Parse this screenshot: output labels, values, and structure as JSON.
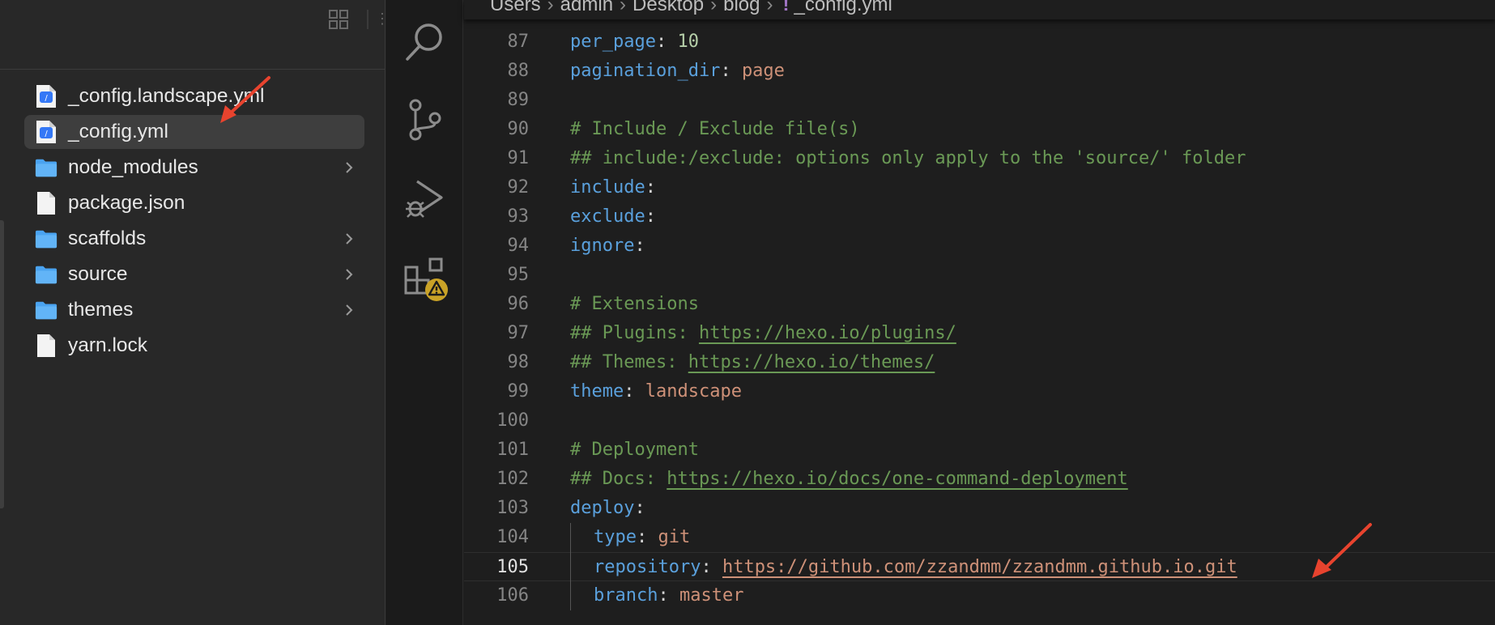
{
  "explorer": {
    "files": [
      {
        "name": "_config.landscape.yml",
        "type": "yaml",
        "selected": false,
        "expandable": false
      },
      {
        "name": "_config.yml",
        "type": "yaml",
        "selected": true,
        "expandable": false
      },
      {
        "name": "node_modules",
        "type": "folder",
        "selected": false,
        "expandable": true
      },
      {
        "name": "package.json",
        "type": "file",
        "selected": false,
        "expandable": false
      },
      {
        "name": "scaffolds",
        "type": "folder",
        "selected": false,
        "expandable": true
      },
      {
        "name": "source",
        "type": "folder",
        "selected": false,
        "expandable": true
      },
      {
        "name": "themes",
        "type": "folder",
        "selected": false,
        "expandable": true
      },
      {
        "name": "yarn.lock",
        "type": "file",
        "selected": false,
        "expandable": false
      }
    ]
  },
  "activity_bar": {
    "icons": [
      "search-icon",
      "source-control-icon",
      "run-debug-icon",
      "extensions-icon"
    ],
    "warning_badge": "warning-icon"
  },
  "editor": {
    "breadcrumb": {
      "items": [
        "Users",
        "admin",
        "Desktop",
        "blog"
      ],
      "file_icon": "!",
      "file": "_config.yml"
    },
    "current_line": "105",
    "lines": [
      {
        "num": "87",
        "key": "per_page",
        "sep": ": ",
        "num_val": "10"
      },
      {
        "num": "88",
        "key": "pagination_dir",
        "sep": ": ",
        "str_val": "page"
      },
      {
        "num": "89"
      },
      {
        "num": "90",
        "comment": "# Include / Exclude file(s)"
      },
      {
        "num": "91",
        "comment": "## include:/exclude: options only apply to the 'source/' folder"
      },
      {
        "num": "92",
        "key": "include",
        "sep": ":"
      },
      {
        "num": "93",
        "key": "exclude",
        "sep": ":"
      },
      {
        "num": "94",
        "key": "ignore",
        "sep": ":"
      },
      {
        "num": "95"
      },
      {
        "num": "96",
        "comment": "# Extensions"
      },
      {
        "num": "97",
        "comment": "## Plugins: ",
        "link": "https://hexo.io/plugins/"
      },
      {
        "num": "98",
        "comment": "## Themes: ",
        "link": "https://hexo.io/themes/"
      },
      {
        "num": "99",
        "key": "theme",
        "sep": ": ",
        "str_val": "landscape"
      },
      {
        "num": "100"
      },
      {
        "num": "101",
        "comment": "# Deployment"
      },
      {
        "num": "102",
        "comment": "## Docs: ",
        "link": "https://hexo.io/docs/one-command-deployment"
      },
      {
        "num": "103",
        "key": "deploy",
        "sep": ":"
      },
      {
        "num": "104",
        "indent": true,
        "key": "type",
        "sep": ": ",
        "str_val": "git"
      },
      {
        "num": "105",
        "indent": true,
        "key": "repository",
        "sep": ": ",
        "str_link": "https://github.com/zzandmm/zzandmm.github.io.git"
      },
      {
        "num": "106",
        "indent": true,
        "key": "branch",
        "sep": ": ",
        "str_val": "master"
      }
    ]
  },
  "colors": {
    "annotation_arrow": "#e8432e",
    "yaml_key": "#5aa0dc",
    "yaml_string": "#ce9178",
    "yaml_comment": "#6a9955",
    "warning_badge": "#c9a227"
  }
}
